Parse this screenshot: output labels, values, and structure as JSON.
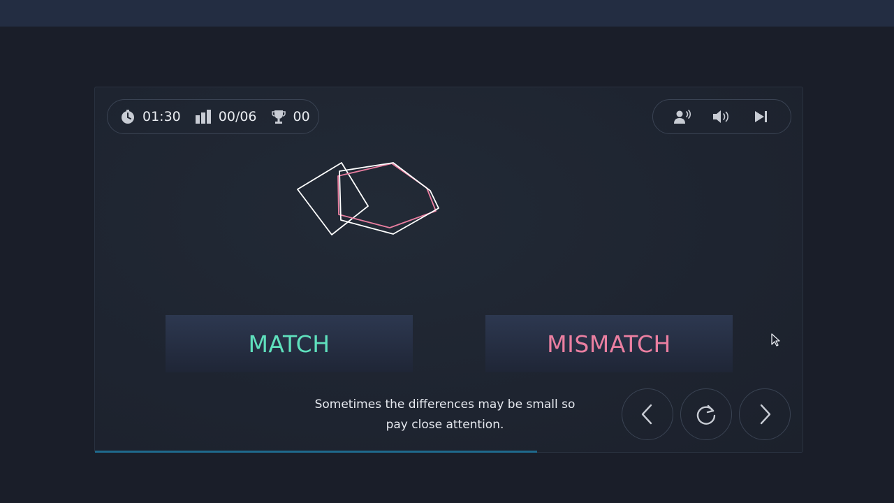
{
  "stats": {
    "timer": "01:30",
    "progress": "00/06",
    "score": "00"
  },
  "buttons": {
    "match_label": "MATCH",
    "mismatch_label": "MISMATCH"
  },
  "hint": {
    "line1": "Sometimes the differences may be small so",
    "line2": "pay close attention."
  },
  "progress_bar": {
    "fraction": 0.625
  },
  "icons": {
    "timer": "timer-icon",
    "progress": "bar-chart-icon",
    "score": "trophy-icon",
    "voice": "voice-icon",
    "sound": "speaker-icon",
    "skip": "skip-icon",
    "prev": "chevron-left-icon",
    "replay": "replay-icon",
    "next": "chevron-right-icon"
  },
  "colors": {
    "match": "#5fe0bd",
    "mismatch": "#eb7fa1",
    "shape_outline": "#ffffff",
    "shape_highlight": "#e97ea0",
    "progress": "#1f6a8c"
  }
}
